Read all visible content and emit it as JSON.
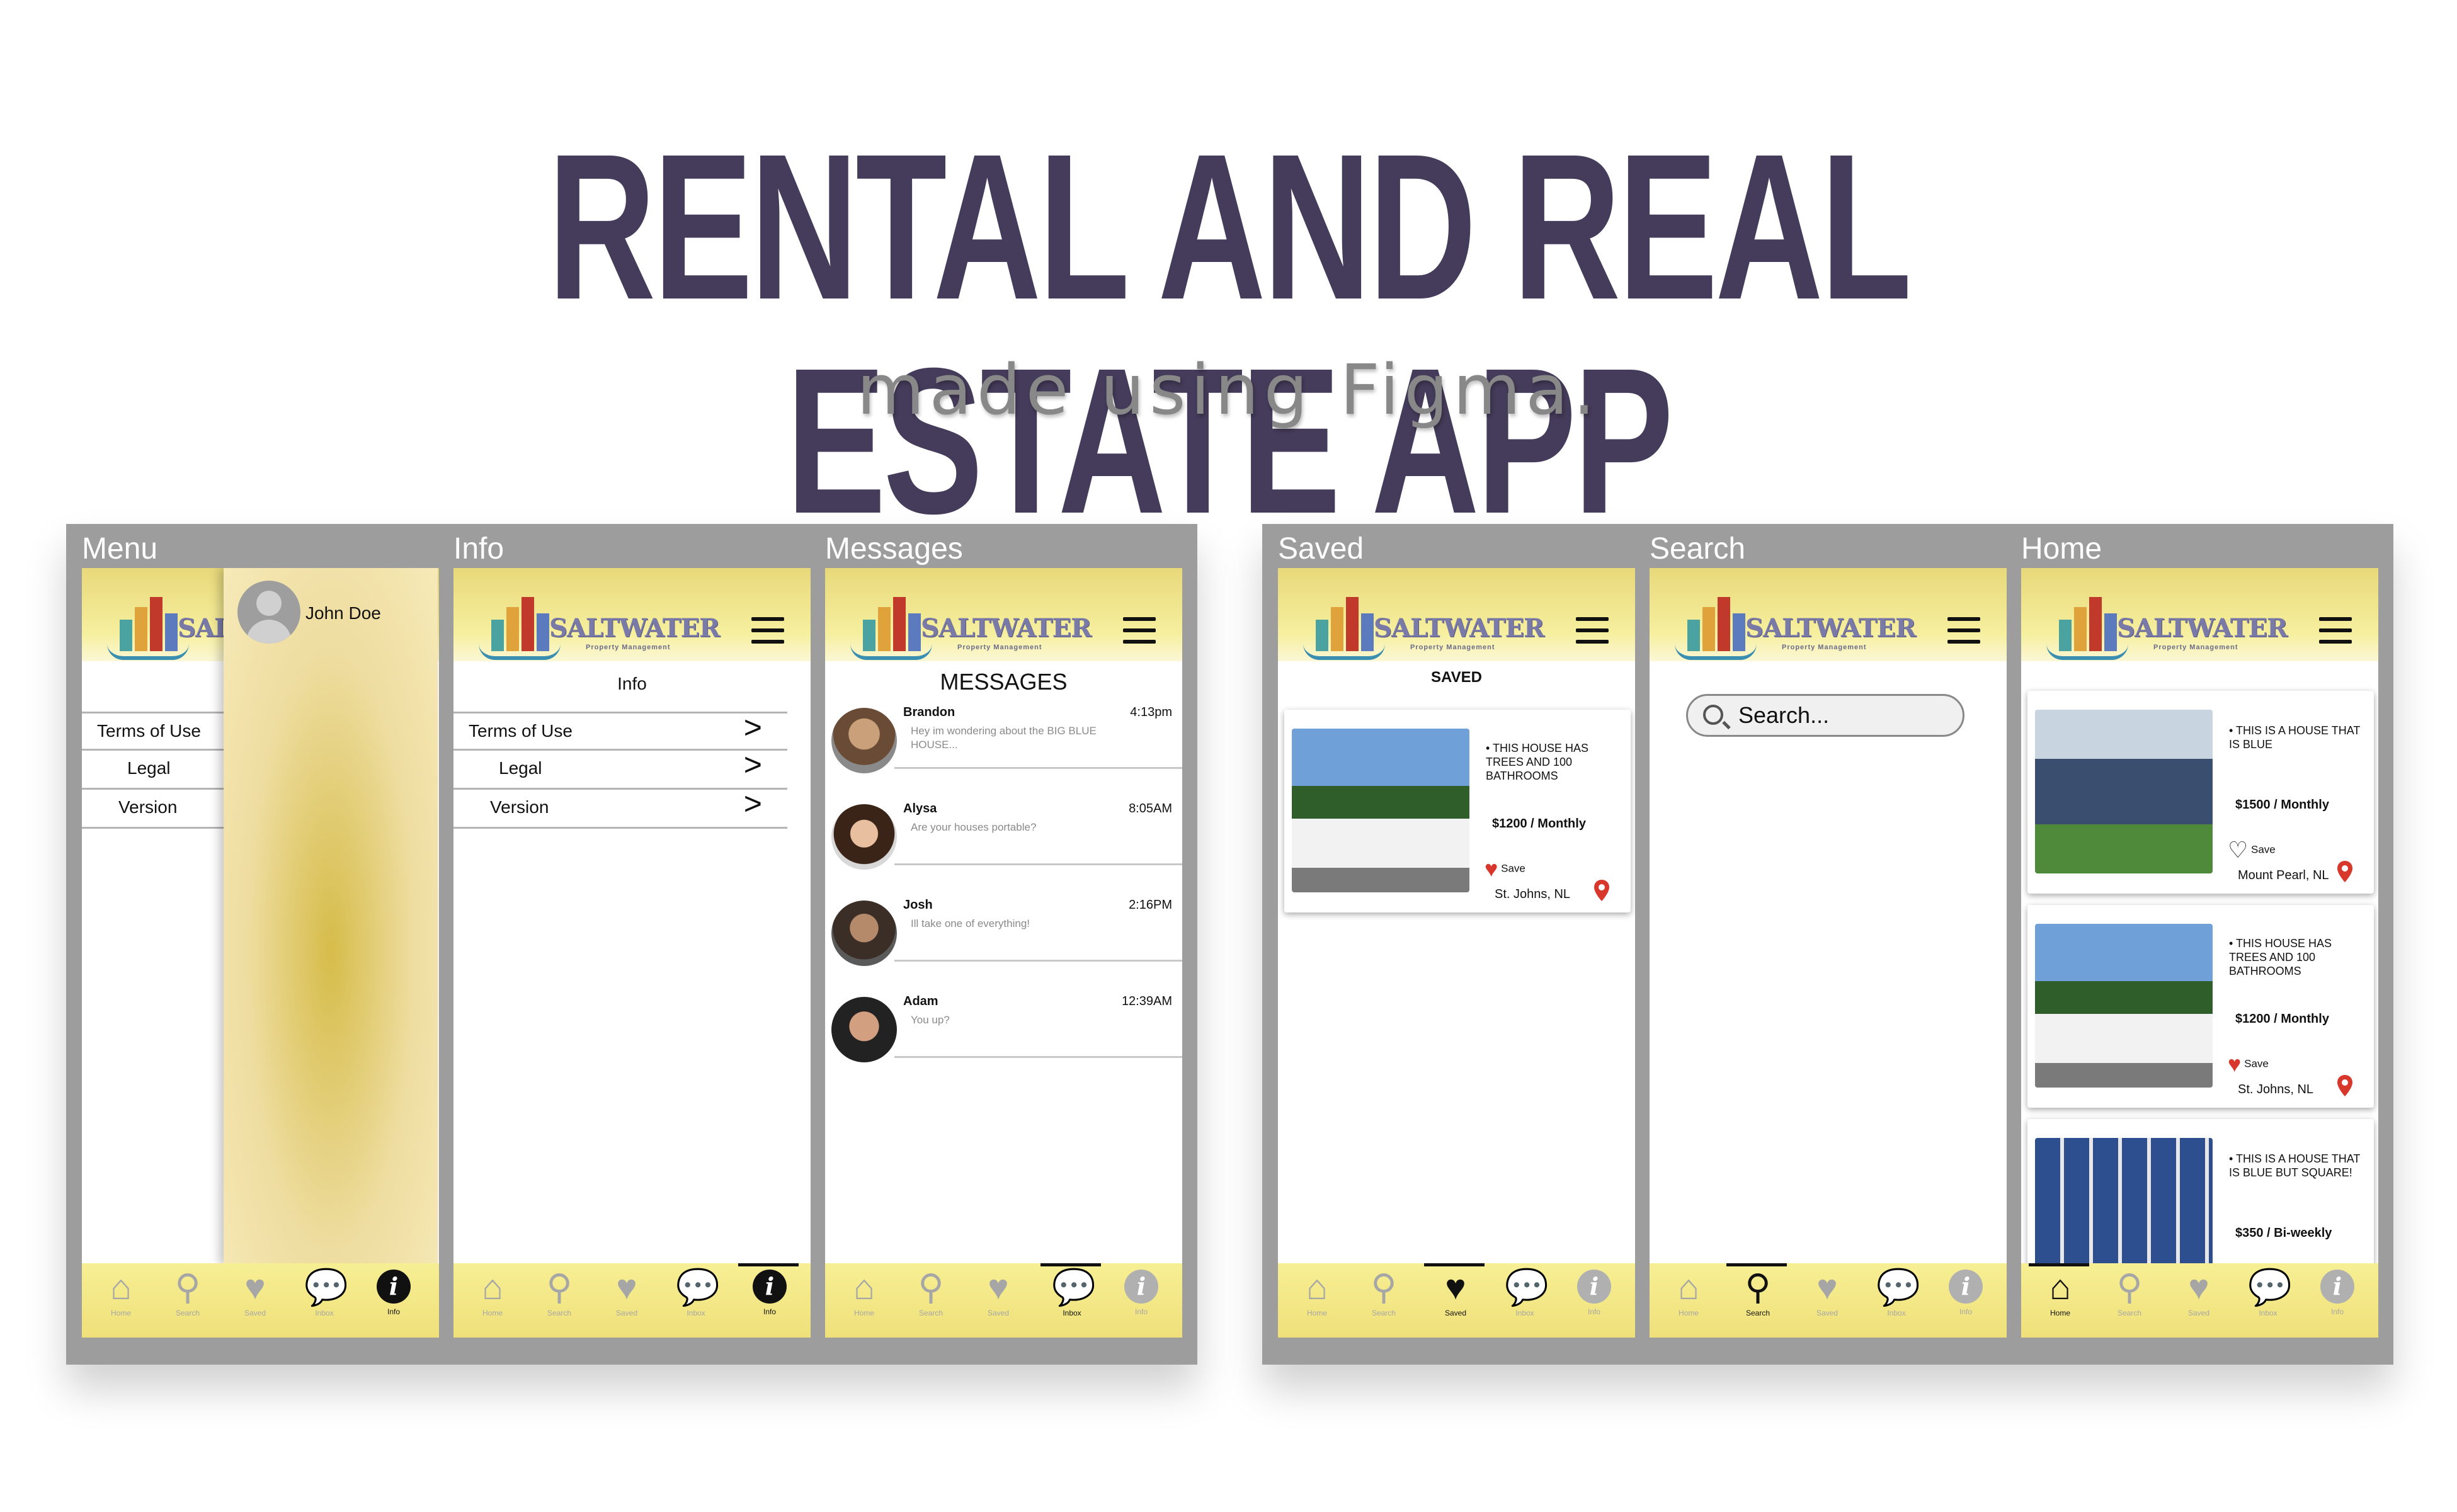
{
  "title": "RENTAL AND REAL ESTATE APP",
  "subtitle": "made using Figma.",
  "brand": {
    "name": "SALTWATER",
    "tagline": "Property Management"
  },
  "nav": {
    "home": "Home",
    "search": "Search",
    "saved": "Saved",
    "inbox": "Inbox",
    "info": "Info"
  },
  "screens": {
    "menu": {
      "label": "Menu",
      "user": "John Doe",
      "items": [
        "Terms of Use",
        "Legal",
        "Version"
      ]
    },
    "info": {
      "label": "Info",
      "heading": "Info",
      "items": [
        "Terms of Use",
        "Legal",
        "Version"
      ],
      "arrow": ">"
    },
    "messages": {
      "label": "Messages",
      "heading": "MESSAGES",
      "list": [
        {
          "name": "Brandon",
          "time": "4:13pm",
          "text": "Hey im wondering about the BIG BLUE HOUSE..."
        },
        {
          "name": "Alysa",
          "time": "8:05AM",
          "text": "Are your houses portable?"
        },
        {
          "name": "Josh",
          "time": "2:16PM",
          "text": "Ill take one of everything!"
        },
        {
          "name": "Adam",
          "time": "12:39AM",
          "text": "You up?"
        }
      ]
    },
    "saved": {
      "label": "Saved",
      "heading": "SAVED"
    },
    "search": {
      "label": "Search",
      "placeholder": "Search..."
    },
    "home": {
      "label": "Home"
    }
  },
  "listings": [
    {
      "desc": "• THIS HOUSE HAS TREES AND 100 BATHROOMS",
      "price": "$1200 / Monthly",
      "save": "Save",
      "location": "St. Johns, NL"
    },
    {
      "desc": "• THIS IS A HOUSE THAT IS BLUE",
      "price": "$1500 / Monthly",
      "save": "Save",
      "location": "Mount Pearl, NL"
    },
    {
      "desc": "• THIS IS A HOUSE THAT IS BLUE BUT SQUARE!",
      "price": "$350 / Bi-weekly"
    }
  ],
  "colors": {
    "title": "#453b5a",
    "header_yellow": "#f6ef9e",
    "heart": "#d8382c",
    "frame": "#9d9d9d"
  }
}
